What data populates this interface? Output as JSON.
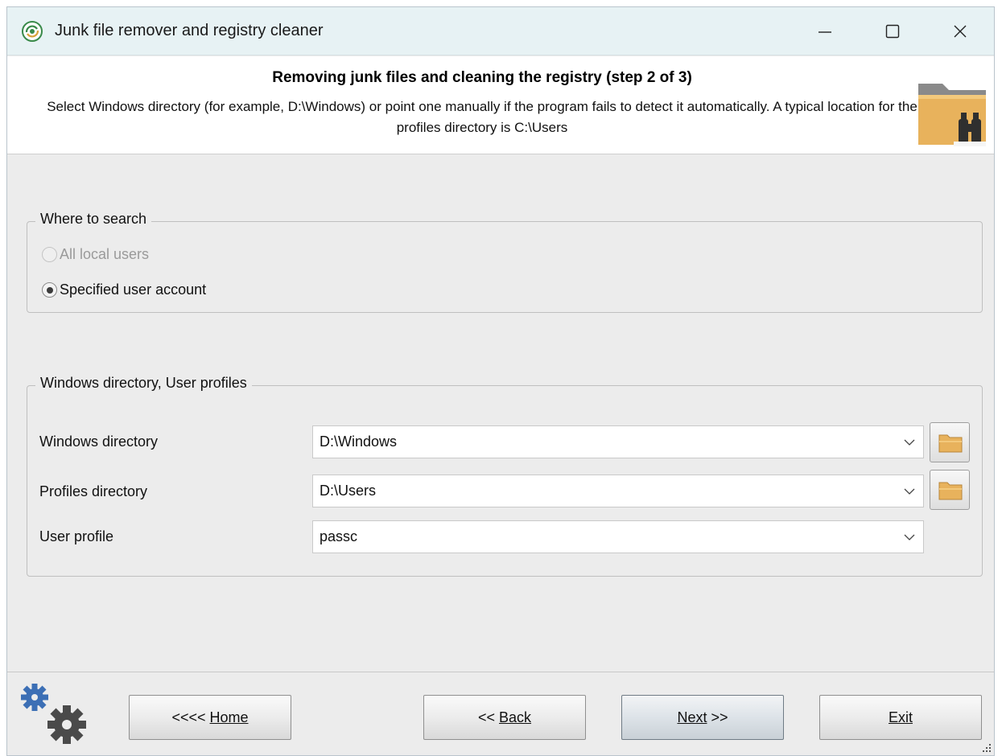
{
  "window": {
    "title": "Junk file remover and registry cleaner",
    "controls": {
      "minimize_icon": "minimize-icon",
      "maximize_icon": "maximize-icon",
      "close_icon": "close-icon"
    }
  },
  "header": {
    "title": "Removing junk files and cleaning the registry (step 2 of 3)",
    "description": "Select Windows directory (for example, D:\\Windows) or point one manually if the program fails to detect it automatically. A typical location for the profiles directory is C:\\Users",
    "icon": "folder-binoculars-icon"
  },
  "where_to_search": {
    "legend": "Where to search",
    "options": [
      {
        "label": "All local users",
        "selected": false,
        "enabled": false
      },
      {
        "label": "Specified user account",
        "selected": true,
        "enabled": true
      }
    ]
  },
  "directories": {
    "legend": "Windows directory, User profiles",
    "fields": [
      {
        "label": "Windows directory",
        "value": "D:\\Windows",
        "has_browse": true
      },
      {
        "label": "Profiles directory",
        "value": "D:\\Users",
        "has_browse": true
      },
      {
        "label": "User profile",
        "value": "passc",
        "has_browse": false
      }
    ]
  },
  "footer": {
    "home_prefix": "<<<< ",
    "home_label": "Home",
    "back_prefix": "<< ",
    "back_label": "Back",
    "next_label": "Next",
    "next_suffix": " >>",
    "exit_label": "Exit"
  },
  "colors": {
    "titlebar_bg": "#e7f2f4",
    "body_bg": "#ececec",
    "folder": "#e8b25c",
    "gear_blue": "#3c6fb5",
    "gear_gray": "#4a4a4a"
  }
}
